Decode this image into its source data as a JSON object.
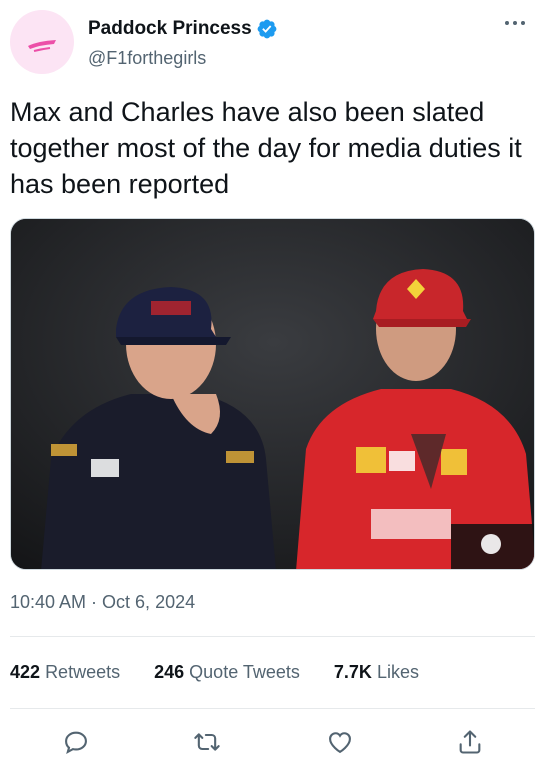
{
  "author": {
    "display_name": "Paddock Princess",
    "handle": "@F1forthegirls",
    "verified_icon": "verified-badge-icon",
    "avatar_bg": "#fce4f4",
    "avatar_mark_color": "#ec4fa8"
  },
  "tweet": {
    "text": "Max and Charles have also been slated together most of the day for media duties it has been reported",
    "timestamp": "10:40 AM · Oct 6, 2024"
  },
  "media": {
    "description_icon": "photo",
    "left_team_color": "#1a1c2b",
    "right_team_color": "#d7262b"
  },
  "stats": {
    "retweets_count": "422",
    "retweets_label": "Retweets",
    "quotes_count": "246",
    "quotes_label": "Quote Tweets",
    "likes_count": "7.7K",
    "likes_label": "Likes"
  },
  "actions": [
    "reply-icon",
    "retweet-icon",
    "like-icon",
    "share-icon"
  ],
  "colors": {
    "accent": "#1d9bf0",
    "secondary_text": "#536471",
    "primary_text": "#0f1419"
  }
}
